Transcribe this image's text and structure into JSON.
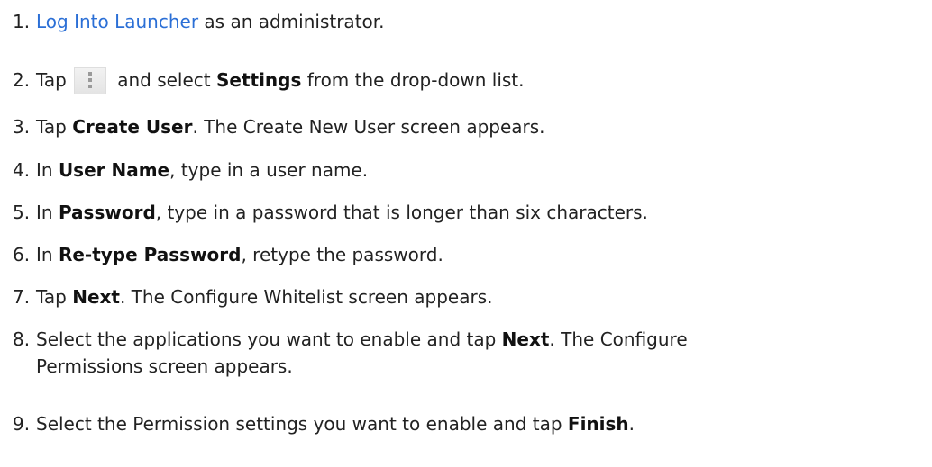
{
  "steps": [
    {
      "num": "1.",
      "link": "Log Into Launcher",
      "after": " as an administrator."
    },
    {
      "num": "2.",
      "pre": "Tap",
      "icon": "more-vert-icon",
      "mid": " and select ",
      "bold": "Settings",
      "after": " from the drop-down list."
    },
    {
      "num": "3.",
      "pre": "Tap ",
      "bold": "Create User",
      "after": ". The Create New User screen appears."
    },
    {
      "num": "4.",
      "pre": "In ",
      "bold": "User Name",
      "after": ", type in a user name."
    },
    {
      "num": "5.",
      "pre": "In ",
      "bold": "Password",
      "after": ", type in a password that is longer than six characters."
    },
    {
      "num": "6.",
      "pre": "In ",
      "bold": "Re-type Password",
      "after": ", retype the password."
    },
    {
      "num": "7.",
      "pre": "Tap ",
      "bold": "Next",
      "after": ". The Configure Whitelist screen appears."
    },
    {
      "num": "8.",
      "pre": "Select the applications you want to enable and tap ",
      "bold": "Next",
      "after": ". The Configure",
      "line2": "Permissions screen appears."
    },
    {
      "num": "9.",
      "pre": "Select the Permission settings you want to enable and tap ",
      "bold": "Finish",
      "after": "."
    }
  ]
}
